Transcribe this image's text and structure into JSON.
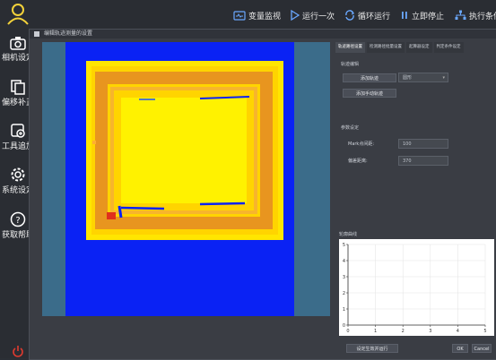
{
  "sidebar": {
    "items": [
      {
        "icon": "user-icon",
        "label": ""
      },
      {
        "icon": "camera-icon",
        "label": "相机设定"
      },
      {
        "icon": "offset-icon",
        "label": "偏移补正"
      },
      {
        "icon": "tool-add-icon",
        "label": "工具追加"
      },
      {
        "icon": "gear-icon",
        "label": "系统设定"
      },
      {
        "icon": "help-icon",
        "label": "获取帮助"
      },
      {
        "icon": "power-icon",
        "label": ""
      }
    ]
  },
  "toolbar": {
    "monitor": "变量监视",
    "run_once": "运行一次",
    "loop_run": "循环运行",
    "stop": "立即停止",
    "exec_cond": "执行条件"
  },
  "window": {
    "title": "编辑轨迹测量的设置"
  },
  "tabs": [
    "轨迹路径设置",
    "检测路径批量设置",
    "起算器设定",
    "判定条件设定"
  ],
  "path_edit": {
    "section": "轨迹编辑",
    "add_path": "添加轨迹",
    "select_value": "圆形",
    "add_manual": "添加手动轨迹"
  },
  "params": {
    "section": "参数设定",
    "mark_label": "Mark点间距:",
    "mark_value": "100",
    "tol_label": "偏差距离:",
    "tol_value": "370"
  },
  "chart_section": "轮廓曲线",
  "chart_data": {
    "type": "line",
    "x_ticks": [
      "0",
      "1",
      "2",
      "3",
      "4",
      "5"
    ],
    "y_ticks": [
      "0",
      "1",
      "2",
      "3",
      "4",
      "5"
    ],
    "xlim": [
      0,
      5
    ],
    "ylim": [
      0,
      5
    ],
    "grid": true,
    "series": []
  },
  "bottom": {
    "run_btn": "设定生效并运行",
    "ok": "OK",
    "cancel": "Cancel"
  },
  "colors": {
    "background_blue": "#0a22f4",
    "yellow": "#fff200",
    "orange": "#ff8c1a"
  }
}
